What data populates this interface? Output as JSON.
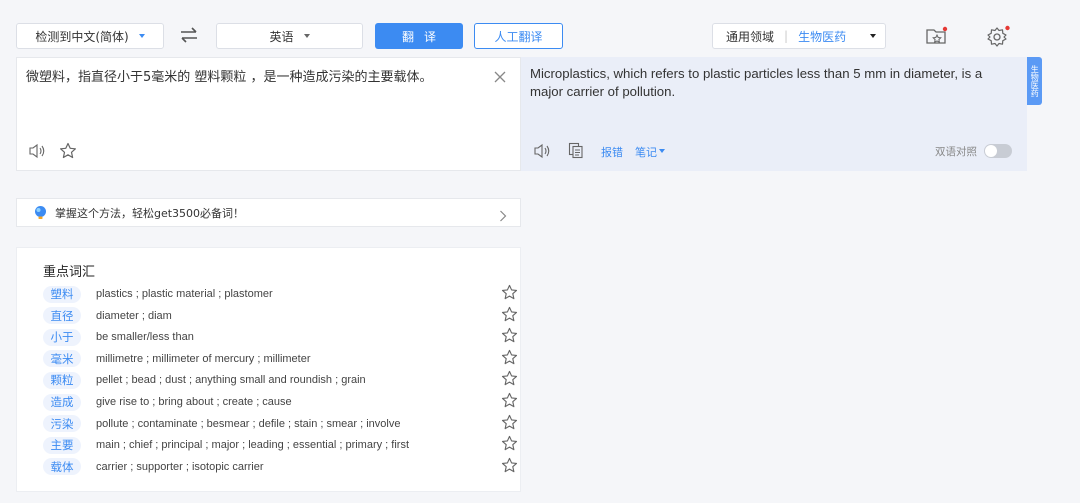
{
  "toolbar": {
    "source_lang": "检测到中文(简体)",
    "target_lang": "英语",
    "translate_button": "翻译",
    "human_translate_button": "人工翻译",
    "domain_general": "通用领域",
    "domain_separator": "|",
    "domain_selected": "生物医药"
  },
  "source": {
    "text": "微塑料，指直径小于5毫米的 塑料颗粒 ，是一种造成污染的主要载体。"
  },
  "target": {
    "text": "Microplastics, which refers to plastic particles less than 5 mm in diameter, is a major carrier of pollution.",
    "report_error": "报错",
    "notes": "笔记",
    "bilingual_label": "双语对照"
  },
  "side_tab": {
    "label": "生物医药"
  },
  "tip": {
    "text": "掌握这个方法，轻松get3500必备词！"
  },
  "vocab": {
    "title": "重点词汇",
    "items": [
      {
        "word": "塑料",
        "definition": "plastics ; plastic material ; plastomer"
      },
      {
        "word": "直径",
        "definition": "diameter ; diam"
      },
      {
        "word": "小于",
        "definition": "be smaller/less than"
      },
      {
        "word": "毫米",
        "definition": "millimetre ; millimeter of mercury ; millimeter"
      },
      {
        "word": "颗粒",
        "definition": "pellet ; bead ; dust ; anything small and roundish ; grain"
      },
      {
        "word": "造成",
        "definition": "give rise to ; bring about ; create ; cause"
      },
      {
        "word": "污染",
        "definition": "pollute ; contaminate ; besmear ; defile ; stain ; smear ; involve"
      },
      {
        "word": "主要",
        "definition": "main ; chief ; principal ; major ; leading ; essential ; primary ; first"
      },
      {
        "word": "载体",
        "definition": "carrier ; supporter ; isotopic carrier"
      }
    ]
  },
  "colors": {
    "accent": "#3c8bf2",
    "target_panel": "#eaeef8",
    "notification_dot": "#e53935"
  }
}
